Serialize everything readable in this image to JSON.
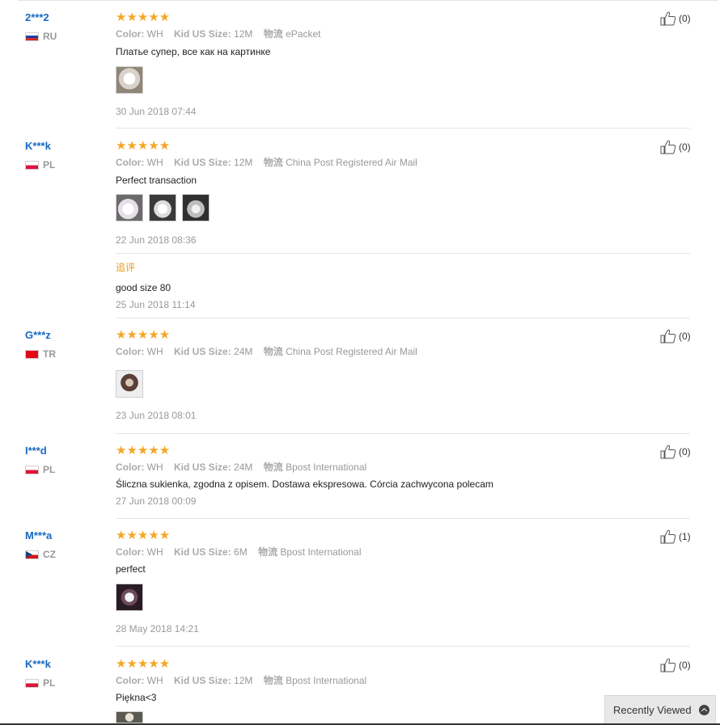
{
  "labels": {
    "color": "Color:",
    "size": "Kid US Size:",
    "shipping": "物流"
  },
  "recently_viewed": {
    "label": "Recently Viewed",
    "icon": "chevron-up-circle-icon"
  },
  "reviews": [
    {
      "user": "2***2",
      "country": "RU",
      "flag_colors": [
        "#ffffff",
        "#1c3fa8",
        "#d52b1e"
      ],
      "rating": 5,
      "stars": "★★★★★",
      "color": "WH",
      "size": "12M",
      "shipping": "ePacket",
      "text": "Платье супер, все как на картинке",
      "photos": 1,
      "date": "30 Jun 2018 07:44",
      "helpful": "(0)"
    },
    {
      "user": "K***k",
      "country": "PL",
      "flag_colors": [
        "#ffffff",
        "#dc143c"
      ],
      "rating": 5,
      "stars": "★★★★★",
      "color": "WH",
      "size": "12M",
      "shipping": "China Post Registered Air Mail",
      "text": "Perfect transaction",
      "photos": 3,
      "date": "22 Jun 2018 08:36",
      "followup": {
        "label": "追评",
        "text": "good size 80",
        "date": "25 Jun 2018 11:14"
      },
      "helpful": "(0)"
    },
    {
      "user": "G***z",
      "country": "TR",
      "flag_colors": [
        "#e30a17"
      ],
      "rating": 5,
      "stars": "★★★★★",
      "color": "WH",
      "size": "24M",
      "shipping": "China Post Registered Air Mail",
      "text": "",
      "photos": 1,
      "date": "23 Jun 2018 08:01",
      "helpful": "(0)"
    },
    {
      "user": "I***d",
      "country": "PL",
      "flag_colors": [
        "#ffffff",
        "#dc143c"
      ],
      "rating": 5,
      "stars": "★★★★★",
      "color": "WH",
      "size": "24M",
      "shipping": "Bpost International",
      "text": "Śliczna sukienka, zgodna z opisem. Dostawa ekspresowa. Córcia zachwycona polecam",
      "photos": 0,
      "date": "27 Jun 2018 00:09",
      "helpful": "(0)"
    },
    {
      "user": "M***a",
      "country": "CZ",
      "flag_colors": [
        "#ffffff",
        "#d7141a",
        "#11457e"
      ],
      "rating": 5,
      "stars": "★★★★★",
      "color": "WH",
      "size": "6M",
      "shipping": "Bpost International",
      "text": "perfect",
      "photos": 1,
      "date": "28 May 2018 14:21",
      "helpful": "(1)"
    },
    {
      "user": "K***k",
      "country": "PL",
      "flag_colors": [
        "#ffffff",
        "#dc143c"
      ],
      "rating": 5,
      "stars": "★★★★★",
      "color": "WH",
      "size": "12M",
      "shipping": "Bpost International",
      "text": "Piękna<3",
      "photos": 1,
      "helpful": "(0)"
    }
  ]
}
